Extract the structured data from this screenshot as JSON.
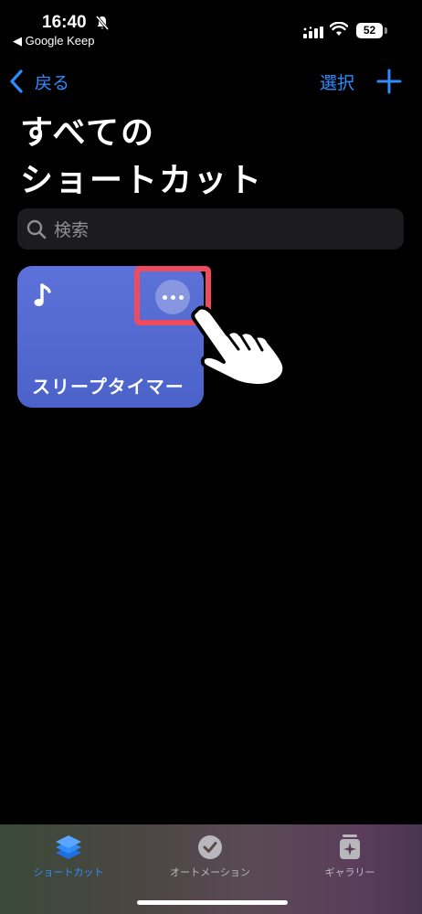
{
  "status_bar": {
    "time": "16:40",
    "back_app": "◀ Google Keep",
    "battery": "52"
  },
  "nav": {
    "back_label": "戻る",
    "select_label": "選択"
  },
  "page": {
    "title_line1": "すべての",
    "title_line2": "ショートカット"
  },
  "search": {
    "placeholder": "検索"
  },
  "shortcut_card": {
    "title": "スリープタイマー",
    "icon": "music-note-icon",
    "color": "#5469d4"
  },
  "tab_bar": {
    "tabs": [
      {
        "label": "ショートカット",
        "icon": "layers-icon",
        "active": true
      },
      {
        "label": "オートメーション",
        "icon": "clock-check-icon",
        "active": false
      },
      {
        "label": "ギャラリー",
        "icon": "gallery-sparkle-icon",
        "active": false
      }
    ]
  },
  "colors": {
    "accent": "#2f8cff",
    "highlight": "#ee4b5f"
  }
}
